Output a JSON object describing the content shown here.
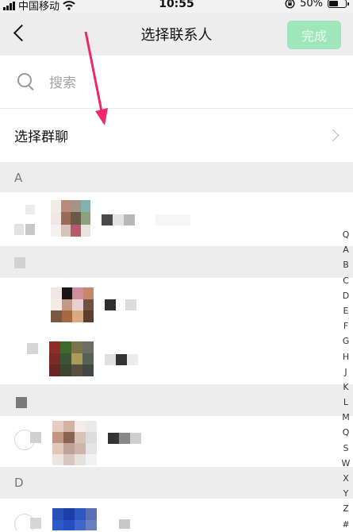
{
  "status_bar": {
    "carrier": "中国移动",
    "time": "10:55",
    "battery": "50%",
    "signal_icon": "signal-bars-icon",
    "wifi_icon": "wifi-icon",
    "lock_icon": "orientation-lock-icon",
    "battery_icon": "battery-icon"
  },
  "nav": {
    "title": "选择联系人",
    "done_label": "完成",
    "back_icon": "back-chevron-icon",
    "done_color": "#9fe6bb"
  },
  "search": {
    "placeholder": "搜索",
    "icon": "search-icon"
  },
  "group_chat": {
    "label": "选择群聊",
    "icon": "chevron-right-icon"
  },
  "sections": [
    {
      "letter": "A"
    },
    {
      "letter": ""
    },
    {
      "letter": ""
    },
    {
      "letter": "D"
    }
  ],
  "index_bar": [
    "Q",
    "A",
    "B",
    "C",
    "D",
    "E",
    "F",
    "G",
    "H",
    "J",
    "K",
    "L",
    "M",
    "Q",
    "S",
    "W",
    "X",
    "Y",
    "Z",
    "#"
  ],
  "annotation": {
    "arrow_color": "#f0286a"
  },
  "colors": {
    "nav_bg": "#ededed",
    "section_bg": "#ededed"
  }
}
